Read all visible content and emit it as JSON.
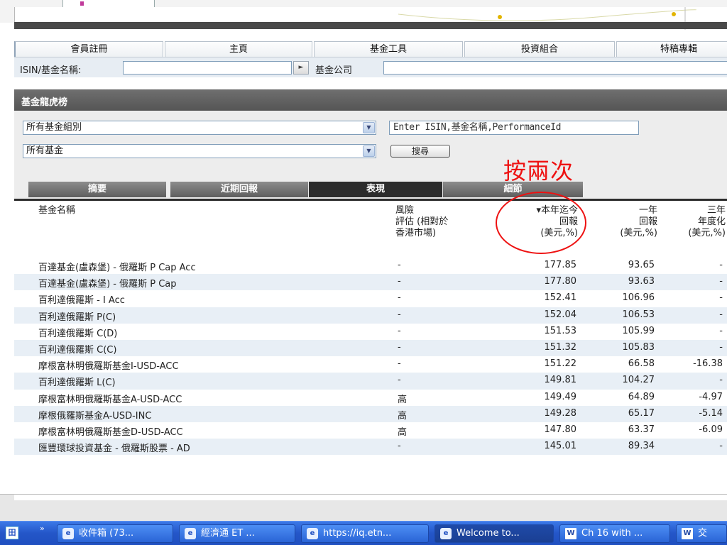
{
  "nav": {
    "tabs": [
      {
        "label": "會員註冊"
      },
      {
        "label": "主頁"
      },
      {
        "label": "基金工具"
      },
      {
        "label": "投資組合"
      },
      {
        "label": "特稿專輯"
      }
    ]
  },
  "search": {
    "isin_label": "ISIN/基金名稱:",
    "isin_go": "►",
    "fund_company_label": "基金公司"
  },
  "panel": {
    "title": "基金龍虎榜",
    "group_select": "所有基金組別",
    "fund_select": "所有基金",
    "fund_search_placeholder": "Enter ISIN,基金名稱,PerformanceId",
    "search_button": "搜尋",
    "annotation": "按兩次"
  },
  "sub_tabs": [
    {
      "label": "摘要"
    },
    {
      "label": "近期回報"
    },
    {
      "label": "表現"
    },
    {
      "label": "細節"
    }
  ],
  "table": {
    "headers": {
      "name": "基金名稱",
      "risk": [
        "風險",
        "評估 (相對於",
        "香港市場)"
      ],
      "ytd": [
        "▾本年迄今",
        "回報",
        "(美元,%)"
      ],
      "one_year": [
        "一年",
        "回報",
        "(美元,%)"
      ],
      "three_year": [
        "三年",
        "年度化",
        "(美元,%)"
      ]
    },
    "rows": [
      {
        "name": "百達基金(盧森堡) - 俄羅斯 P Cap Acc",
        "risk": "-",
        "ytd": "177.85",
        "one_year": "93.65",
        "three_year": "-"
      },
      {
        "name": "百達基金(盧森堡) - 俄羅斯 P Cap",
        "risk": "-",
        "ytd": "177.80",
        "one_year": "93.63",
        "three_year": "-"
      },
      {
        "name": "百利達俄羅斯 - I Acc",
        "risk": "-",
        "ytd": "152.41",
        "one_year": "106.96",
        "three_year": "-"
      },
      {
        "name": "百利達俄羅斯 P(C)",
        "risk": "-",
        "ytd": "152.04",
        "one_year": "106.53",
        "three_year": "-"
      },
      {
        "name": "百利達俄羅斯 C(D)",
        "risk": "-",
        "ytd": "151.53",
        "one_year": "105.99",
        "three_year": "-"
      },
      {
        "name": "百利達俄羅斯 C(C)",
        "risk": "-",
        "ytd": "151.32",
        "one_year": "105.83",
        "three_year": "-"
      },
      {
        "name": "摩根富林明俄羅斯基金I-USD-ACC",
        "risk": "-",
        "ytd": "151.22",
        "one_year": "66.58",
        "three_year": "-16.38"
      },
      {
        "name": "百利達俄羅斯 L(C)",
        "risk": "-",
        "ytd": "149.81",
        "one_year": "104.27",
        "three_year": "-"
      },
      {
        "name": "摩根富林明俄羅斯基金A-USD-ACC",
        "risk": "高",
        "ytd": "149.49",
        "one_year": "64.89",
        "three_year": "-4.97"
      },
      {
        "name": "摩根俄羅斯基金A-USD-INC",
        "risk": "高",
        "ytd": "149.28",
        "one_year": "65.17",
        "three_year": "-5.14"
      },
      {
        "name": "摩根富林明俄羅斯基金D-USD-ACC",
        "risk": "高",
        "ytd": "147.80",
        "one_year": "63.37",
        "three_year": "-6.09"
      },
      {
        "name": "匯豐環球投資基金 - 俄羅斯股票 - AD",
        "risk": "-",
        "ytd": "145.01",
        "one_year": "89.34",
        "three_year": "-"
      }
    ]
  },
  "taskbar": {
    "logo": "田",
    "chevron": "»",
    "buttons": [
      {
        "label": "收件箱 (73...",
        "icon": "e"
      },
      {
        "label": "經濟通 ET ...",
        "icon": "e"
      },
      {
        "label": "https://iq.etn...",
        "icon": "e"
      },
      {
        "label": "Welcome to...",
        "icon": "e"
      },
      {
        "label": "Ch 16 with ...",
        "icon": "W"
      },
      {
        "label": "交",
        "icon": "W"
      }
    ]
  }
}
